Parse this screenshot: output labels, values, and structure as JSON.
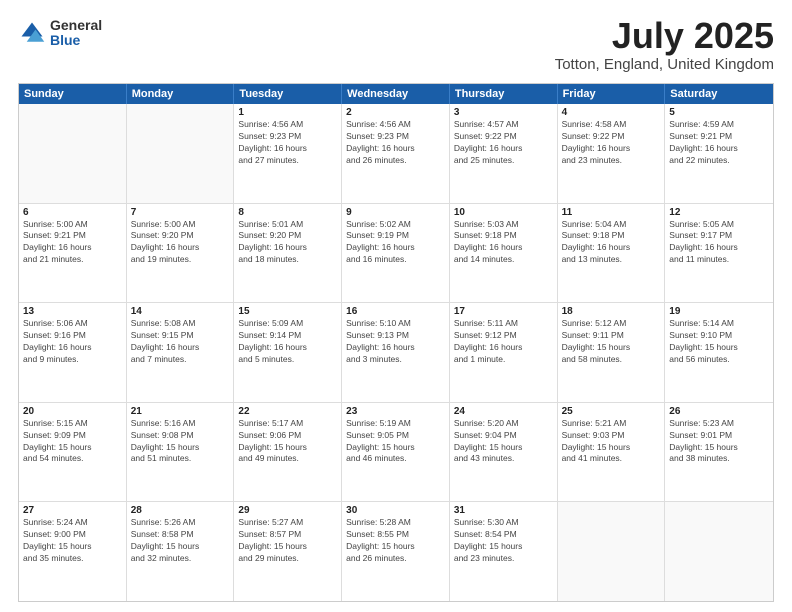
{
  "logo": {
    "general": "General",
    "blue": "Blue"
  },
  "title": {
    "month": "July 2025",
    "location": "Totton, England, United Kingdom"
  },
  "calendar": {
    "headers": [
      "Sunday",
      "Monday",
      "Tuesday",
      "Wednesday",
      "Thursday",
      "Friday",
      "Saturday"
    ],
    "rows": [
      [
        {
          "day": "",
          "lines": [],
          "empty": true
        },
        {
          "day": "",
          "lines": [],
          "empty": true
        },
        {
          "day": "1",
          "lines": [
            "Sunrise: 4:56 AM",
            "Sunset: 9:23 PM",
            "Daylight: 16 hours",
            "and 27 minutes."
          ],
          "empty": false
        },
        {
          "day": "2",
          "lines": [
            "Sunrise: 4:56 AM",
            "Sunset: 9:23 PM",
            "Daylight: 16 hours",
            "and 26 minutes."
          ],
          "empty": false
        },
        {
          "day": "3",
          "lines": [
            "Sunrise: 4:57 AM",
            "Sunset: 9:22 PM",
            "Daylight: 16 hours",
            "and 25 minutes."
          ],
          "empty": false
        },
        {
          "day": "4",
          "lines": [
            "Sunrise: 4:58 AM",
            "Sunset: 9:22 PM",
            "Daylight: 16 hours",
            "and 23 minutes."
          ],
          "empty": false
        },
        {
          "day": "5",
          "lines": [
            "Sunrise: 4:59 AM",
            "Sunset: 9:21 PM",
            "Daylight: 16 hours",
            "and 22 minutes."
          ],
          "empty": false
        }
      ],
      [
        {
          "day": "6",
          "lines": [
            "Sunrise: 5:00 AM",
            "Sunset: 9:21 PM",
            "Daylight: 16 hours",
            "and 21 minutes."
          ],
          "empty": false
        },
        {
          "day": "7",
          "lines": [
            "Sunrise: 5:00 AM",
            "Sunset: 9:20 PM",
            "Daylight: 16 hours",
            "and 19 minutes."
          ],
          "empty": false
        },
        {
          "day": "8",
          "lines": [
            "Sunrise: 5:01 AM",
            "Sunset: 9:20 PM",
            "Daylight: 16 hours",
            "and 18 minutes."
          ],
          "empty": false
        },
        {
          "day": "9",
          "lines": [
            "Sunrise: 5:02 AM",
            "Sunset: 9:19 PM",
            "Daylight: 16 hours",
            "and 16 minutes."
          ],
          "empty": false
        },
        {
          "day": "10",
          "lines": [
            "Sunrise: 5:03 AM",
            "Sunset: 9:18 PM",
            "Daylight: 16 hours",
            "and 14 minutes."
          ],
          "empty": false
        },
        {
          "day": "11",
          "lines": [
            "Sunrise: 5:04 AM",
            "Sunset: 9:18 PM",
            "Daylight: 16 hours",
            "and 13 minutes."
          ],
          "empty": false
        },
        {
          "day": "12",
          "lines": [
            "Sunrise: 5:05 AM",
            "Sunset: 9:17 PM",
            "Daylight: 16 hours",
            "and 11 minutes."
          ],
          "empty": false
        }
      ],
      [
        {
          "day": "13",
          "lines": [
            "Sunrise: 5:06 AM",
            "Sunset: 9:16 PM",
            "Daylight: 16 hours",
            "and 9 minutes."
          ],
          "empty": false
        },
        {
          "day": "14",
          "lines": [
            "Sunrise: 5:08 AM",
            "Sunset: 9:15 PM",
            "Daylight: 16 hours",
            "and 7 minutes."
          ],
          "empty": false
        },
        {
          "day": "15",
          "lines": [
            "Sunrise: 5:09 AM",
            "Sunset: 9:14 PM",
            "Daylight: 16 hours",
            "and 5 minutes."
          ],
          "empty": false
        },
        {
          "day": "16",
          "lines": [
            "Sunrise: 5:10 AM",
            "Sunset: 9:13 PM",
            "Daylight: 16 hours",
            "and 3 minutes."
          ],
          "empty": false
        },
        {
          "day": "17",
          "lines": [
            "Sunrise: 5:11 AM",
            "Sunset: 9:12 PM",
            "Daylight: 16 hours",
            "and 1 minute."
          ],
          "empty": false
        },
        {
          "day": "18",
          "lines": [
            "Sunrise: 5:12 AM",
            "Sunset: 9:11 PM",
            "Daylight: 15 hours",
            "and 58 minutes."
          ],
          "empty": false
        },
        {
          "day": "19",
          "lines": [
            "Sunrise: 5:14 AM",
            "Sunset: 9:10 PM",
            "Daylight: 15 hours",
            "and 56 minutes."
          ],
          "empty": false
        }
      ],
      [
        {
          "day": "20",
          "lines": [
            "Sunrise: 5:15 AM",
            "Sunset: 9:09 PM",
            "Daylight: 15 hours",
            "and 54 minutes."
          ],
          "empty": false
        },
        {
          "day": "21",
          "lines": [
            "Sunrise: 5:16 AM",
            "Sunset: 9:08 PM",
            "Daylight: 15 hours",
            "and 51 minutes."
          ],
          "empty": false
        },
        {
          "day": "22",
          "lines": [
            "Sunrise: 5:17 AM",
            "Sunset: 9:06 PM",
            "Daylight: 15 hours",
            "and 49 minutes."
          ],
          "empty": false
        },
        {
          "day": "23",
          "lines": [
            "Sunrise: 5:19 AM",
            "Sunset: 9:05 PM",
            "Daylight: 15 hours",
            "and 46 minutes."
          ],
          "empty": false
        },
        {
          "day": "24",
          "lines": [
            "Sunrise: 5:20 AM",
            "Sunset: 9:04 PM",
            "Daylight: 15 hours",
            "and 43 minutes."
          ],
          "empty": false
        },
        {
          "day": "25",
          "lines": [
            "Sunrise: 5:21 AM",
            "Sunset: 9:03 PM",
            "Daylight: 15 hours",
            "and 41 minutes."
          ],
          "empty": false
        },
        {
          "day": "26",
          "lines": [
            "Sunrise: 5:23 AM",
            "Sunset: 9:01 PM",
            "Daylight: 15 hours",
            "and 38 minutes."
          ],
          "empty": false
        }
      ],
      [
        {
          "day": "27",
          "lines": [
            "Sunrise: 5:24 AM",
            "Sunset: 9:00 PM",
            "Daylight: 15 hours",
            "and 35 minutes."
          ],
          "empty": false
        },
        {
          "day": "28",
          "lines": [
            "Sunrise: 5:26 AM",
            "Sunset: 8:58 PM",
            "Daylight: 15 hours",
            "and 32 minutes."
          ],
          "empty": false
        },
        {
          "day": "29",
          "lines": [
            "Sunrise: 5:27 AM",
            "Sunset: 8:57 PM",
            "Daylight: 15 hours",
            "and 29 minutes."
          ],
          "empty": false
        },
        {
          "day": "30",
          "lines": [
            "Sunrise: 5:28 AM",
            "Sunset: 8:55 PM",
            "Daylight: 15 hours",
            "and 26 minutes."
          ],
          "empty": false
        },
        {
          "day": "31",
          "lines": [
            "Sunrise: 5:30 AM",
            "Sunset: 8:54 PM",
            "Daylight: 15 hours",
            "and 23 minutes."
          ],
          "empty": false
        },
        {
          "day": "",
          "lines": [],
          "empty": true
        },
        {
          "day": "",
          "lines": [],
          "empty": true
        }
      ]
    ]
  }
}
